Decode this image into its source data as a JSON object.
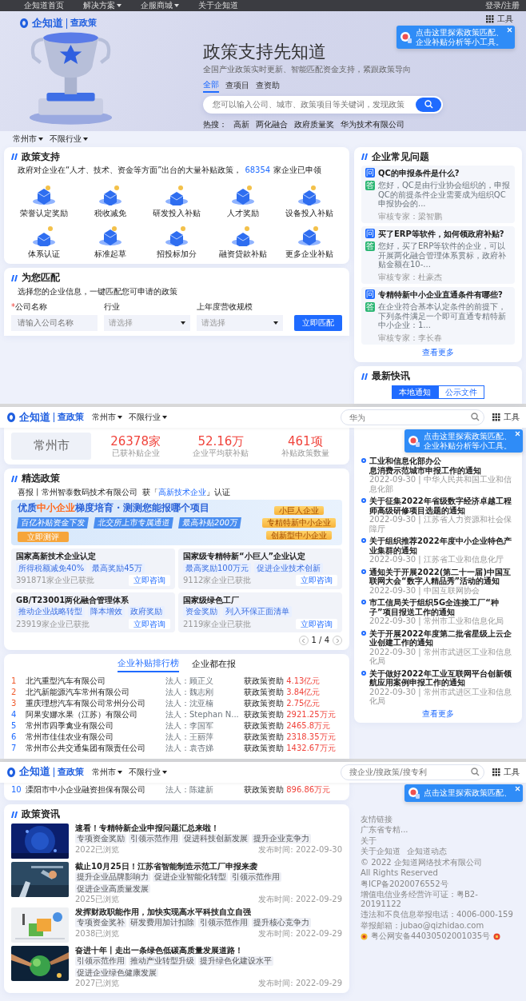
{
  "top_bar": {
    "links": [
      {
        "label": "企知道首页",
        "dropdown": false
      },
      {
        "label": "解决方案",
        "dropdown": true
      },
      {
        "label": "企服商城",
        "dropdown": true
      },
      {
        "label": "关于企知道",
        "dropdown": false
      }
    ],
    "login": "登录/注册"
  },
  "hero": {
    "logo": {
      "brand": "企知道",
      "product": "查政策"
    },
    "tools": "工具",
    "tooltip": [
      "点击这里探索政策匹配、",
      "企业补贴分析等小工具。"
    ],
    "title": "政策支持先知道",
    "subtitle": "全国产业政策实时更新、智能匹配资金支持，紧跟政策导向",
    "search_tabs": [
      {
        "label": "全部",
        "selected": true
      },
      {
        "label": "查项目",
        "selected": false
      },
      {
        "label": "查资助",
        "selected": false
      }
    ],
    "search": {
      "placeholder": "您可以输入公司、城市、政策项目等关键词，发现政策"
    },
    "hot": {
      "label": "热搜：",
      "terms": [
        "高新",
        "两化融合",
        "政府质量奖",
        "华为技术有限公司"
      ]
    }
  },
  "filters": [
    "常州市",
    "不限行业"
  ],
  "policy_support": {
    "title": "政策支持",
    "intro": "政府对企业在“人才、技术、资金等方面”出台的大量补贴政策，",
    "count": "68354",
    "count_suffix": "家企业已申领",
    "categories": [
      "荣誉认定奖励",
      "税收减免",
      "研发投入补贴",
      "人才奖励",
      "设备投入补贴",
      "体系认证",
      "标准起草",
      "招投标加分",
      "融资贷款补贴",
      "更多企业补贴"
    ]
  },
  "faq": {
    "title": "企业常见问题",
    "more": "查看更多",
    "items": [
      {
        "question_badge": "问",
        "answer_badge": "答",
        "question": "QC的申报条件是什么?",
        "answer": "您好，QC是由行业协会组织的，申报QC的前提条件企业需要成为组织QC申报协会的...",
        "expert": "审核专家：梁智鹏"
      },
      {
        "question_badge": "问",
        "answer_badge": "答",
        "question": "买了ERP等软件，如何领政府补贴?",
        "answer": "您好，买了ERP等软件的企业，可以开展两化融合管理体系贯标，政府补贴金额在10-...",
        "expert": "审核专家：杜豪杰"
      },
      {
        "question_badge": "问",
        "answer_badge": "答",
        "question": "专精特新中小企业直通条件有哪些?",
        "answer": "在企业符合基本认定条件的前提下，下列条件满足一个即可直通专精特新中小企业：1...",
        "expert": "审核专家：李长春"
      }
    ]
  },
  "match": {
    "title": "为您匹配",
    "intro": "选择您的企业信息，一键匹配您可申请的政策",
    "required_mark": "*",
    "button": "立即匹配",
    "fields": [
      {
        "label": "公司名称",
        "required": true,
        "kind": "text",
        "placeholder": "请输入公司名称"
      },
      {
        "label": "行业",
        "required": false,
        "kind": "select",
        "placeholder": "请选择"
      },
      {
        "label": "上年度营收规模",
        "required": false,
        "kind": "select",
        "placeholder": "请选择"
      }
    ]
  },
  "news_card": {
    "title": "最新快讯",
    "tabs": [
      {
        "label": "本地通知",
        "selected": true
      },
      {
        "label": "公示文件",
        "selected": false
      }
    ]
  },
  "sticky_headers": [
    {
      "logo": {
        "brand": "企知道",
        "product": "查政策"
      },
      "filters": [
        "常州市",
        "不限行业"
      ],
      "search": {
        "placeholder": "华为"
      },
      "tools": "工具",
      "tooltip": [
        "点击这里探索政策匹配、",
        "企业补贴分析等小工具。"
      ]
    },
    {
      "logo": {
        "brand": "企知道",
        "product": "查政策"
      },
      "filters": [
        "常州市",
        "不限行业"
      ],
      "search": {
        "placeholder": "搜企业/搜政策/搜专利"
      },
      "tools": "工具",
      "tooltip": [
        "点击这里探索政策匹配、"
      ]
    }
  ],
  "stats": {
    "city": "常州市",
    "items": [
      {
        "value": "26378家",
        "label": "已获补贴企业"
      },
      {
        "value": "52.16万",
        "label": "企业平均获补贴"
      },
      {
        "value": "461项",
        "label": "补贴政策数量"
      }
    ]
  },
  "selected_policies": {
    "title": "精选政策",
    "ticker": [
      {
        "text": "喜报丨常州智泰数码技术有限公司  获「",
        "highlight": false
      },
      {
        "text": "高新技术企业",
        "highlight": true
      },
      {
        "text": "」认证",
        "highlight": false
      }
    ],
    "banner": {
      "title": [
        {
          "text": "优质",
          "highlight": false
        },
        {
          "text": "中小企业",
          "highlight": true
        },
        {
          "text": "梯度培育・测测您能报哪个项目",
          "highlight": false
        }
      ],
      "tags": [
        "百亿补贴资金下发",
        "北交所上市专属通道",
        "最高补贴200万"
      ],
      "button": "立即测评",
      "levels": [
        "小巨人企业",
        "专精特新中小企业",
        "创新型中小企业"
      ]
    },
    "cards": [
      {
        "title": "国家高新技术企业认定",
        "tags": [
          "所得税额减免40%",
          "最高奖励45万"
        ],
        "approved": "391871家企业已获批",
        "button": "立即咨询"
      },
      {
        "title": "国家级专精特新“小巨人”企业认定",
        "tags": [
          "最高奖励100万元",
          "促进企业技术创新"
        ],
        "approved": "9112家企业已获批",
        "button": "立即咨询"
      },
      {
        "title": "GB/T23001两化融合管理体系",
        "tags": [
          "推动企业战略转型",
          "降本增效",
          "政府奖励"
        ],
        "approved": "23919家企业已获批",
        "button": "立即咨询"
      },
      {
        "title": "国家级绿色工厂",
        "tags": [
          "资金奖励",
          "列入环保正面清单"
        ],
        "approved": "2119家企业已获批",
        "button": "立即咨询"
      }
    ],
    "pager": "1 / 4"
  },
  "ranking": {
    "tabs": [
      {
        "label": "企业补贴排行榜",
        "selected": true
      },
      {
        "label": "企业都在报",
        "selected": false
      }
    ],
    "rows": [
      {
        "rank": "1",
        "company": "北汽重型汽车有限公司",
        "legal": "法人：顾正义",
        "funding_label": "获政策资助",
        "amount": "4.13亿元"
      },
      {
        "rank": "2",
        "company": "北汽新能源汽车常州有限公司",
        "legal": "法人：魏志刚",
        "funding_label": "获政策资助",
        "amount": "3.84亿元"
      },
      {
        "rank": "3",
        "company": "重庆理想汽车有限公司常州分公司",
        "legal": "法人：沈亚楠",
        "funding_label": "获政策资助",
        "amount": "2.75亿元"
      },
      {
        "rank": "4",
        "company": "阿果安娜水果（江苏）有限公司",
        "legal": "法人：Stephan N...",
        "funding_label": "获政策资助",
        "amount": "2921.25万元"
      },
      {
        "rank": "5",
        "company": "常州市四季禽业有限公司",
        "legal": "法人：李国军",
        "funding_label": "获政策资助",
        "amount": "2465.8万元"
      },
      {
        "rank": "6",
        "company": "常州市佳佳农业有限公司",
        "legal": "法人：王丽萍",
        "funding_label": "获政策资助",
        "amount": "2318.35万元"
      },
      {
        "rank": "7",
        "company": "常州市公共交通集团有限责任公司",
        "legal": "法人：袁杏娣",
        "funding_label": "获政策资助",
        "amount": "1432.67万元"
      }
    ],
    "rows_after_cut": [
      {
        "rank": "10",
        "company": "溧阳市中小企业融资担保有限公司",
        "legal": "法人：陈建新",
        "funding_label": "获政策资助",
        "amount": "896.86万元"
      }
    ]
  },
  "news_list": {
    "items": [
      {
        "title_parts": [
          "工业和信息化部办公",
          "息消费示范城市申报工作的通知"
        ],
        "meta": "2022-09-30 | 中华人民共和国工业和信息化部"
      },
      {
        "title_parts": [
          "关于征集2022年省级数字经济卓越工程师高级研修项目选题的通知"
        ],
        "meta": "2022-09-30 | 江苏省人力资源和社会保障厅"
      },
      {
        "title_parts": [
          "关于组织推荐2022年度中小企业特色产业集群的通知"
        ],
        "meta": "2022-09-30 | 江苏省工业和信息化厅"
      },
      {
        "title_parts": [
          "通知关于开展2022(第二十一届)中国互联网大会“数字人精品秀”活动的通知"
        ],
        "meta": "2022-09-30 | 中国互联网协会"
      },
      {
        "title_parts": [
          "市工信局关于组织5G全连接工厂“种子”项目报送工作的通知"
        ],
        "meta": "2022-09-30 | 常州市工业和信息化局"
      },
      {
        "title_parts": [
          "关于开展2022年度第二批省星级上云企业创建工作的通知"
        ],
        "meta": "2022-09-30 | 常州市武进区工业和信息化局"
      },
      {
        "title_parts": [
          "关于做好2022年工业互联网平台创新领航应用案例申报工作的通知"
        ],
        "meta": "2022-09-30 | 常州市武进区工业和信息化局"
      }
    ],
    "more": "查看更多"
  },
  "footer": {
    "groups": [
      {
        "heading": "友情链接",
        "links": [
          "广东省专精..."
        ]
      },
      {
        "heading": "关于",
        "links": [
          "关于企知道",
          "企知道动态"
        ]
      }
    ],
    "lines": [
      "© 2022 企知道网络技术有限公司",
      "All Rights Reserved",
      "粤ICP备2020076552号",
      "增值电信业务经营许可证：粤B2-20191122",
      "违法和不良信息举报电话：4006-000-159",
      "举报邮箱：jubao@qizhidao.com"
    ],
    "police": "粤公网安备44030502001035号"
  },
  "policy_news": {
    "title": "政策资讯",
    "items": [
      {
        "title": "速看！专精特新企业申报问题汇总来啦！",
        "tags": [
          "专项资金奖励",
          "引领示范作用",
          "促进科技创新发展",
          "提升企业竞争力"
        ],
        "views": "2022已浏览",
        "published": "发布时间: 2022-09-30"
      },
      {
        "title": "截止10月25日！江苏省智能制造示范工厂申报来袭",
        "tags": [
          "提升企业品牌影响力",
          "促进企业智能化转型",
          "引领示范作用",
          "促进企业高质量发展"
        ],
        "views": "2025已浏览",
        "published": "发布时间: 2022-09-29"
      },
      {
        "title": "发挥财政职能作用，加快实现高水平科技自立自强",
        "tags": [
          "专项资金奖补",
          "研发费用加计扣除",
          "引领示范作用",
          "提升核心竞争力"
        ],
        "views": "2038已浏览",
        "published": "发布时间: 2022-09-29"
      },
      {
        "title": "奋进十年丨走出一条绿色低碳高质量发展道路！",
        "tags": [
          "引领示范作用",
          "推动产业转型升级",
          "提升绿色化建设水平",
          "促进企业绿色健康发展"
        ],
        "views": "2027已浏览",
        "published": "发布时间: 2022-09-29"
      }
    ]
  }
}
